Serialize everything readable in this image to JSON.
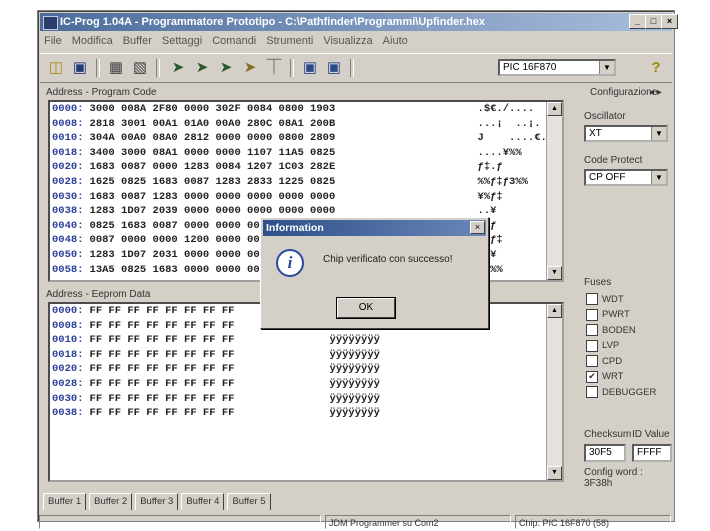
{
  "window": {
    "title": "IC-Prog 1.04A - Programmatore Prototipo - C:\\Pathfinder\\Programmi\\Upfinder.hex",
    "min_label": "_",
    "max_label": "□",
    "close_label": "×"
  },
  "menu": [
    "File",
    "Modifica",
    "Buffer",
    "Settaggi",
    "Comandi",
    "Strumenti",
    "Visualizza",
    "Aiuto"
  ],
  "toolbar": {
    "icons": [
      "open-icon",
      "save-icon",
      "chip-icon",
      "chip-icon",
      "program-icon",
      "read-icon",
      "verify-icon",
      "erase-icon",
      "blank-check-icon",
      "view-icon",
      "view-icon",
      "help-icon"
    ],
    "device": "PIC 16F870",
    "help_glyph": "?"
  },
  "program_code": {
    "label": "Address - Program Code",
    "rows": [
      {
        "addr": "0000:",
        "hex": "3000 008A 2F80 0000 302F 0084 0800 1903",
        "ascii": ".$€./...."
      },
      {
        "addr": "0008:",
        "hex": "2818 3001 00A1 01A0 00A0 280C 08A1 200B",
        "ascii": "...¡  ..¡."
      },
      {
        "addr": "0010:",
        "hex": "304A 00A0 08A0 2812 0000 0000 0800 2809",
        "ascii": "J    ....€."
      },
      {
        "addr": "0018:",
        "hex": "3400 3000 08A1 0000 0000 1107 11A5 0825",
        "ascii": "....¥%%"
      },
      {
        "addr": "0020:",
        "hex": "1683 0087 0000 1283 0084 1207 1C03 282E",
        "ascii": "ƒ‡.ƒ"
      },
      {
        "addr": "0028:",
        "hex": "1625 0825 1683 0087 1283 2833 1225 0825",
        "ascii": "%%ƒ‡ƒ3%%"
      },
      {
        "addr": "0030:",
        "hex": "1683 0087 1283 0000 0000 0000 0000 0000",
        "ascii": "¥%ƒ‡"
      },
      {
        "addr": "0038:",
        "hex": "1283 1D07 2039 0000 0000 0000 0000 0000",
        "ascii": "..¥"
      },
      {
        "addr": "0040:",
        "hex": "0825 1683 0087 0000 0000 0000 0000 0000",
        "ascii": "‡%ƒ"
      },
      {
        "addr": "0048:",
        "hex": "0087 0000 0000 1200 0000 0000 0000 0000",
        "ascii": "¥%ƒ‡"
      },
      {
        "addr": "0050:",
        "hex": "1283 1D07 2031 0000 0000 0000 0000 0000",
        "ascii": "..¥"
      },
      {
        "addr": "0058:",
        "hex": "13A5 0825 1683 0000 0000 0000 0000 0000",
        "ascii": "ƒ.%%"
      }
    ]
  },
  "eeprom": {
    "label": "Address - Eeprom Data",
    "rows": [
      {
        "addr": "0000:",
        "hex": "FF FF FF FF FF FF FF FF",
        "ascii": "ÿÿÿÿÿÿÿÿ"
      },
      {
        "addr": "0008:",
        "hex": "FF FF FF FF FF FF FF FF",
        "ascii": "ÿÿÿÿÿÿÿÿ"
      },
      {
        "addr": "0010:",
        "hex": "FF FF FF FF FF FF FF FF",
        "ascii": "ÿÿÿÿÿÿÿÿ"
      },
      {
        "addr": "0018:",
        "hex": "FF FF FF FF FF FF FF FF",
        "ascii": "ÿÿÿÿÿÿÿÿ"
      },
      {
        "addr": "0020:",
        "hex": "FF FF FF FF FF FF FF FF",
        "ascii": "ÿÿÿÿÿÿÿÿ"
      },
      {
        "addr": "0028:",
        "hex": "FF FF FF FF FF FF FF FF",
        "ascii": "ÿÿÿÿÿÿÿÿ"
      },
      {
        "addr": "0030:",
        "hex": "FF FF FF FF FF FF FF FF",
        "ascii": "ÿÿÿÿÿÿÿÿ"
      },
      {
        "addr": "0038:",
        "hex": "FF FF FF FF FF FF FF FF",
        "ascii": "ÿÿÿÿÿÿÿÿ"
      }
    ]
  },
  "config": {
    "title": "Configurazione",
    "nav": "◂ ▸",
    "oscillator_label": "Oscillator",
    "oscillator_value": "XT",
    "code_protect_label": "Code Protect",
    "code_protect_value": "CP OFF",
    "fuses_label": "Fuses",
    "fuses": [
      {
        "name": "WDT",
        "checked": false
      },
      {
        "name": "PWRT",
        "checked": false
      },
      {
        "name": "BODEN",
        "checked": false
      },
      {
        "name": "LVP",
        "checked": false
      },
      {
        "name": "CPD",
        "checked": false
      },
      {
        "name": "WRT",
        "checked": true
      },
      {
        "name": "DEBUGGER",
        "checked": false
      }
    ],
    "checksum_label": "Checksum",
    "checksum_value": "30F5",
    "id_label": "ID Value",
    "id_value": "FFFF",
    "config_word": "Config word : 3F38h"
  },
  "dialog": {
    "title": "Information",
    "close": "×",
    "icon_glyph": "i",
    "message": "Chip verificato con successo!",
    "ok_label": "OK"
  },
  "tabs": [
    "Buffer 1",
    "Buffer 2",
    "Buffer 3",
    "Buffer 4",
    "Buffer 5"
  ],
  "status": {
    "left": "",
    "middle": "JDM Programmer su Com2",
    "right": "Chip: PIC 16F870  (58)"
  },
  "scroll": {
    "up": "▲",
    "down": "▼"
  },
  "combo_arrow": "▼"
}
